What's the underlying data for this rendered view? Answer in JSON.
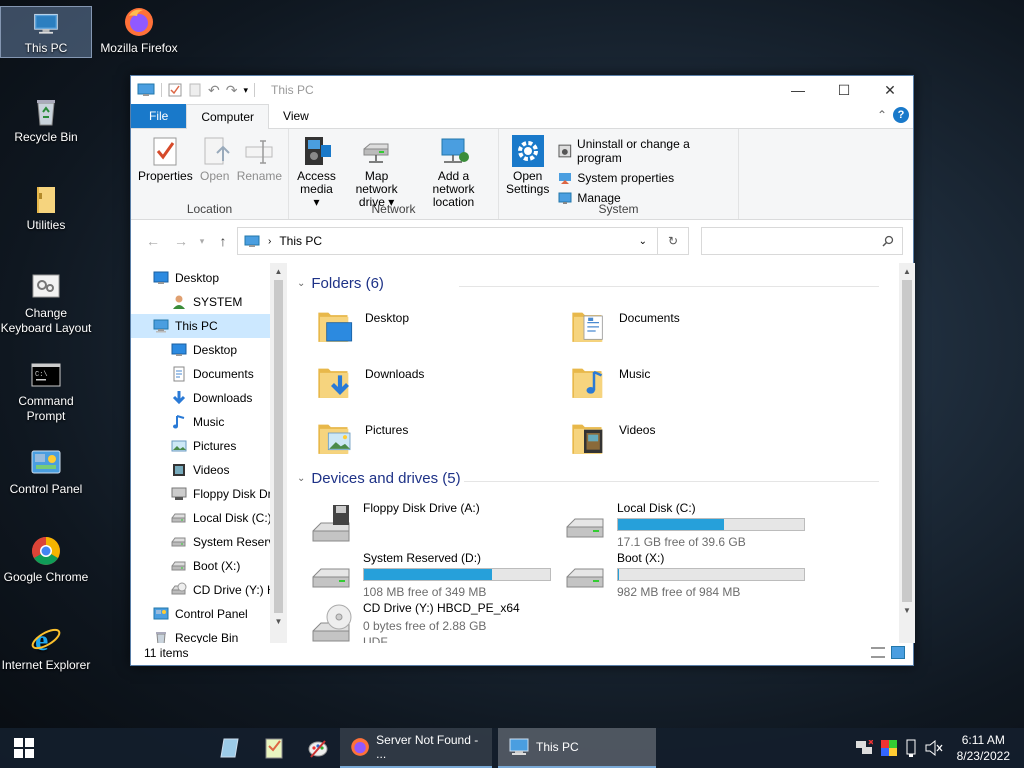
{
  "desktop": {
    "icons": [
      {
        "label": "This PC",
        "icon": "computer-icon"
      },
      {
        "label": "Mozilla Firefox",
        "icon": "firefox-icon"
      },
      {
        "label": "Recycle Bin",
        "icon": "recycle-bin-icon"
      },
      {
        "label": "Utilities",
        "icon": "folder-icon"
      },
      {
        "label": "Change Keyboard Layout",
        "icon": "keyboard-layout-icon"
      },
      {
        "label": "Command Prompt",
        "icon": "command-prompt-icon"
      },
      {
        "label": "Control Panel",
        "icon": "control-panel-icon"
      },
      {
        "label": "Google Chrome",
        "icon": "chrome-icon"
      },
      {
        "label": "Internet Explorer",
        "icon": "ie-icon"
      }
    ]
  },
  "window": {
    "title": "This PC",
    "tabs": {
      "file": "File",
      "computer": "Computer",
      "view": "View"
    },
    "ribbon": {
      "location": {
        "name": "Location",
        "properties": "Properties",
        "open": "Open",
        "rename": "Rename"
      },
      "network": {
        "name": "Network",
        "access_media_1": "Access",
        "access_media_2": "media",
        "map_drive_1": "Map network",
        "map_drive_2": "drive",
        "add_location_1": "Add a network",
        "add_location_2": "location"
      },
      "system": {
        "name": "System",
        "open_settings_1": "Open",
        "open_settings_2": "Settings",
        "uninstall": "Uninstall or change a program",
        "system_properties": "System properties",
        "manage": "Manage"
      }
    },
    "address": {
      "path": "This PC",
      "search_placeholder": ""
    },
    "nav_items": [
      {
        "label": "Desktop",
        "icon": "desktop-icon",
        "indent": 1
      },
      {
        "label": "SYSTEM",
        "icon": "user-icon",
        "indent": 2
      },
      {
        "label": "This PC",
        "icon": "computer-icon",
        "indent": 1,
        "selected": true
      },
      {
        "label": "Desktop",
        "icon": "desktop-icon",
        "indent": 2
      },
      {
        "label": "Documents",
        "icon": "documents-icon",
        "indent": 2
      },
      {
        "label": "Downloads",
        "icon": "downloads-icon",
        "indent": 2
      },
      {
        "label": "Music",
        "icon": "music-icon",
        "indent": 2
      },
      {
        "label": "Pictures",
        "icon": "pictures-icon",
        "indent": 2
      },
      {
        "label": "Videos",
        "icon": "videos-icon",
        "indent": 2
      },
      {
        "label": "Floppy Disk Dri",
        "icon": "floppy-icon",
        "indent": 2
      },
      {
        "label": "Local Disk (C:)",
        "icon": "drive-icon",
        "indent": 2
      },
      {
        "label": "System Reserve",
        "icon": "drive-icon",
        "indent": 2
      },
      {
        "label": "Boot (X:)",
        "icon": "drive-icon",
        "indent": 2
      },
      {
        "label": "CD Drive (Y:) H",
        "icon": "cd-icon",
        "indent": 2
      },
      {
        "label": "Control Panel",
        "icon": "control-panel-icon",
        "indent": 1
      },
      {
        "label": "Recycle Bin",
        "icon": "recycle-bin-icon",
        "indent": 1
      }
    ],
    "folders_header": "Folders (6)",
    "folders": [
      {
        "label": "Desktop",
        "icon": "desktop-folder-icon"
      },
      {
        "label": "Documents",
        "icon": "documents-folder-icon"
      },
      {
        "label": "Downloads",
        "icon": "downloads-folder-icon"
      },
      {
        "label": "Music",
        "icon": "music-folder-icon"
      },
      {
        "label": "Pictures",
        "icon": "pictures-folder-icon"
      },
      {
        "label": "Videos",
        "icon": "videos-folder-icon"
      }
    ],
    "devices_header": "Devices and drives (5)",
    "drives": [
      {
        "label": "Floppy Disk Drive (A:)",
        "icon": "floppy-drive-icon",
        "has_bar": false,
        "free": ""
      },
      {
        "label": "Local Disk (C:)",
        "icon": "hard-drive-icon",
        "has_bar": true,
        "used_fraction": 0.57,
        "free": "17.1 GB free of 39.6 GB"
      },
      {
        "label": "System Reserved (D:)",
        "icon": "hard-drive-icon",
        "has_bar": true,
        "used_fraction": 0.69,
        "free": "108 MB free of 349 MB"
      },
      {
        "label": "Boot (X:)",
        "icon": "hard-drive-icon",
        "has_bar": true,
        "used_fraction": 0.002,
        "free": "982 MB free of 984 MB"
      },
      {
        "label": "CD Drive (Y:) HBCD_PE_x64",
        "icon": "cd-drive-icon",
        "has_bar": false,
        "free": "0 bytes free of 2.88 GB",
        "extra": "UDF"
      }
    ],
    "status": "11 items"
  },
  "taskbar": {
    "apps": [
      {
        "label": "Server Not Found - ...",
        "icon": "firefox-icon",
        "state": "open"
      },
      {
        "label": "This PC",
        "icon": "explorer-icon",
        "state": "active"
      }
    ],
    "clock": {
      "time": "6:11 AM",
      "date": "8/23/2022"
    }
  },
  "colors": {
    "accent": "#1979ca",
    "drive_bar": "#26a0da",
    "folder": "#f1c65a"
  }
}
